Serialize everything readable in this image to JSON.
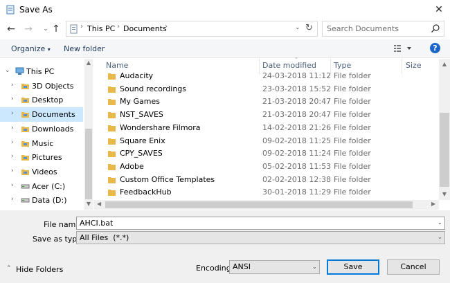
{
  "window": {
    "title": "Save As",
    "icon": "notepad-icon"
  },
  "address": {
    "breadcrumbs": [
      "This PC",
      "Documents"
    ],
    "search_placeholder": "Search Documents"
  },
  "toolbar": {
    "organize": "Organize",
    "new_folder": "New folder",
    "help": "?"
  },
  "nav": {
    "items": [
      {
        "label": "This PC",
        "icon": "computer-icon"
      },
      {
        "label": "3D Objects",
        "icon": "cube-folder-icon"
      },
      {
        "label": "Desktop",
        "icon": "desktop-folder-icon"
      },
      {
        "label": "Documents",
        "icon": "documents-folder-icon",
        "selected": true
      },
      {
        "label": "Downloads",
        "icon": "downloads-folder-icon"
      },
      {
        "label": "Music",
        "icon": "music-folder-icon"
      },
      {
        "label": "Pictures",
        "icon": "pictures-folder-icon"
      },
      {
        "label": "Videos",
        "icon": "videos-folder-icon"
      },
      {
        "label": "Acer (C:)",
        "icon": "drive-icon"
      },
      {
        "label": "Data (D:)",
        "icon": "drive-icon"
      }
    ]
  },
  "files": {
    "columns": [
      "Name",
      "Date modified",
      "Type",
      "Size"
    ],
    "rows": [
      {
        "name": "Audacity",
        "date": "24-03-2018 11:12",
        "type": "File folder"
      },
      {
        "name": "Sound recordings",
        "date": "23-03-2018 15:52",
        "type": "File folder"
      },
      {
        "name": "My Games",
        "date": "21-03-2018 20:47",
        "type": "File folder"
      },
      {
        "name": "NST_SAVES",
        "date": "21-03-2018 20:47",
        "type": "File folder"
      },
      {
        "name": "Wondershare Filmora",
        "date": "14-02-2018 21:26",
        "type": "File folder"
      },
      {
        "name": "Square Enix",
        "date": "09-02-2018 11:25",
        "type": "File folder"
      },
      {
        "name": "CPY_SAVES",
        "date": "09-02-2018 11:24",
        "type": "File folder"
      },
      {
        "name": "Adobe",
        "date": "05-02-2018 11:53",
        "type": "File folder"
      },
      {
        "name": "Custom Office Templates",
        "date": "02-02-2018 12:38",
        "type": "File folder"
      },
      {
        "name": "FeedbackHub",
        "date": "30-01-2018 11:29",
        "type": "File folder"
      }
    ]
  },
  "form": {
    "file_name_label": "File name:",
    "file_name_value": "AHCI.bat",
    "save_as_type_label": "Save as type:",
    "save_as_type_value": "All Files  (*.*)",
    "encoding_label": "Encoding:",
    "encoding_value": "ANSI",
    "hide_folders": "Hide Folders",
    "save": "Save",
    "cancel": "Cancel"
  },
  "colors": {
    "selection": "#cce8ff",
    "accent": "#0078d7",
    "folder": "#e8b94a"
  }
}
